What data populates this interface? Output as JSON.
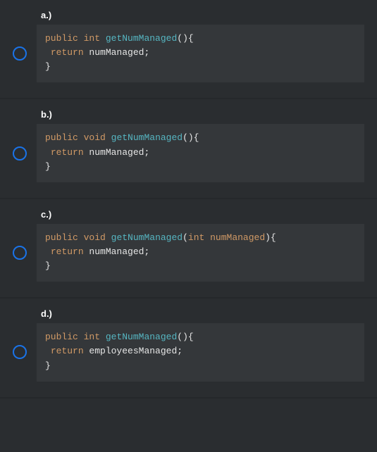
{
  "options": [
    {
      "label": "a.)",
      "code": {
        "kw1": "public",
        "kw2": "int",
        "fn": "getNumManaged",
        "parens": "(){",
        "kw3": "return",
        "ret": " numManaged;",
        "close": "}"
      }
    },
    {
      "label": "b.)",
      "code": {
        "kw1": "public",
        "kw2": "void",
        "fn": "getNumManaged",
        "parens": "(){",
        "kw3": "return",
        "ret": " numManaged;",
        "close": "}"
      }
    },
    {
      "label": "c.)",
      "code": {
        "kw1": "public",
        "kw2": "void",
        "fn": "getNumManaged",
        "paren_open": "(",
        "param_type": "int",
        "param_name": "numManaged",
        "paren_close": "){",
        "kw3": "return",
        "ret": " numManaged;",
        "close": "}"
      }
    },
    {
      "label": "d.)",
      "code": {
        "kw1": "public",
        "kw2": "int",
        "fn": "getNumManaged",
        "parens": "(){",
        "kw3": "return",
        "ret": " employeesManaged;",
        "close": "}"
      }
    }
  ]
}
